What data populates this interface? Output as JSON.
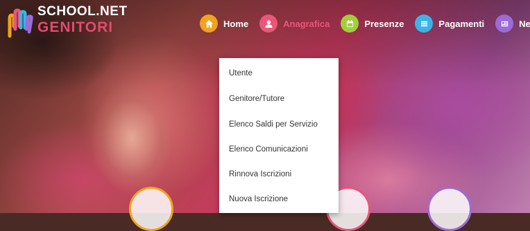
{
  "logo": {
    "line1": "SCHOOL.NET",
    "line2": "GENITORI"
  },
  "nav": {
    "items": [
      {
        "label": "Home",
        "icon": "home-icon",
        "color": "#f0a31c"
      },
      {
        "label": "Anagrafica",
        "icon": "user-icon",
        "color": "#e9567a",
        "active": true
      },
      {
        "label": "Presenze",
        "icon": "calendar-icon",
        "color": "#9fcf3a"
      },
      {
        "label": "Pagamenti",
        "icon": "list-icon",
        "color": "#3bb4e5"
      },
      {
        "label": "News",
        "icon": "newspaper-icon",
        "color": "#9b6bd6"
      }
    ]
  },
  "dropdown": {
    "items": [
      "Utente",
      "Genitore/Tutore",
      "Elenco Saldi per Servizio",
      "Elenco Comunicazioni",
      "Rinnova Iscrizioni",
      "Nuova Iscrizione"
    ]
  },
  "colors": {
    "accent": "#e9567a",
    "dropdown_bg": "#ffffff"
  }
}
